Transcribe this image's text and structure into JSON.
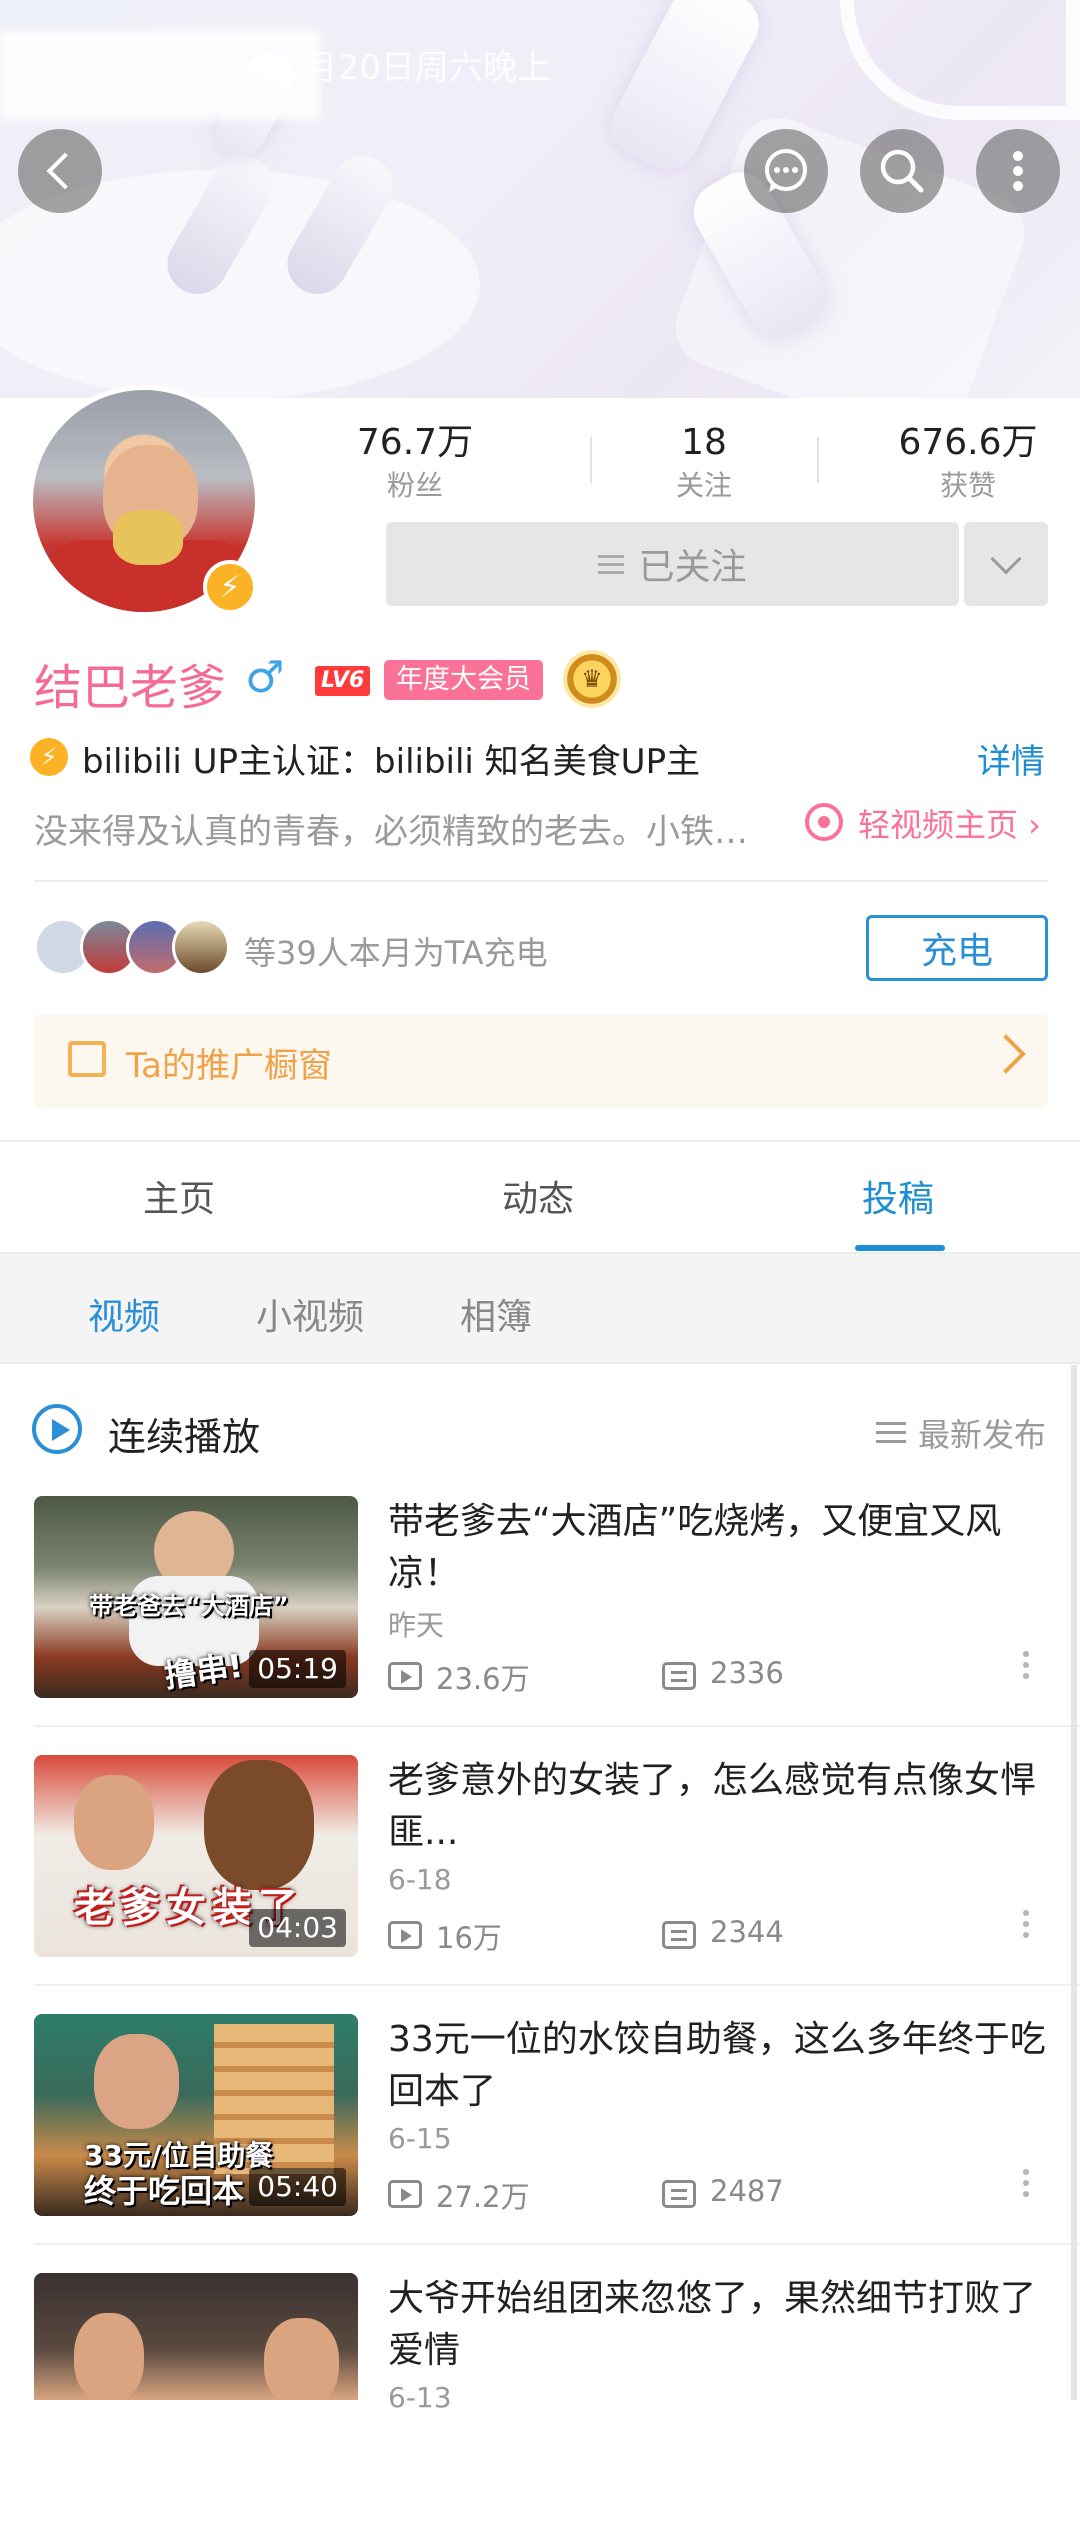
{
  "status_bar": {
    "date": "6月20日周六晚上"
  },
  "header_icons": {
    "back": "back-arrow-icon",
    "message": "chat-bubble-icon",
    "search": "search-icon",
    "more": "more-vertical-icon"
  },
  "profile": {
    "stats": [
      {
        "value": "76.7万",
        "label": "粉丝"
      },
      {
        "value": "18",
        "label": "关注"
      },
      {
        "value": "676.6万",
        "label": "获赞"
      }
    ],
    "follow_label": "已关注",
    "name": "结巴老爹",
    "gender_symbol": "♂",
    "level": "LV6",
    "vip_label": "年度大会员",
    "verify_text": "bilibili UP主认证：bilibili 知名美食UP主",
    "detail_label": "详情",
    "sign": "没来得及认真的青春，必须精致的老去。小铁…",
    "light_video_label": "轻视频主页 ›"
  },
  "charge": {
    "text": "等39人本月为TA充电",
    "button": "充电"
  },
  "shop": {
    "label": "Ta的推广橱窗"
  },
  "tabs": [
    "主页",
    "动态",
    "投稿"
  ],
  "subtabs": [
    "视频",
    "小视频",
    "相簿"
  ],
  "list_header": {
    "play_all": "连续播放",
    "sort": "最新发布"
  },
  "videos": [
    {
      "title": "带老爹去“大酒店”吃烧烤，又便宜又风凉！",
      "date": "昨天",
      "plays": "23.6万",
      "danmaku": "2336",
      "duration": "05:19",
      "caption_top": "带老爸去“大酒店”",
      "caption_bottom": "撸串!"
    },
    {
      "title": "老爹意外的女装了，怎么感觉有点像女悍匪...",
      "date": "6-18",
      "plays": "16万",
      "danmaku": "2344",
      "duration": "04:03",
      "caption_top": "老爹女装了",
      "caption_bottom": ""
    },
    {
      "title": "33元一位的水饺自助餐，这么多年终于吃回本了",
      "date": "6-15",
      "plays": "27.2万",
      "danmaku": "2487",
      "duration": "05:40",
      "caption_top": "33元/位自助餐",
      "caption_bottom": "终于吃回本"
    },
    {
      "title": "大爷开始组团来忽悠了，果然细节打败了爱情",
      "date": "6-13",
      "plays": "",
      "danmaku": "",
      "duration": "",
      "caption_top": "",
      "caption_bottom": ""
    }
  ],
  "colors": {
    "accent_blue": "#1e8ed3",
    "pink": "#fb7299",
    "orange": "#f0a24a"
  }
}
